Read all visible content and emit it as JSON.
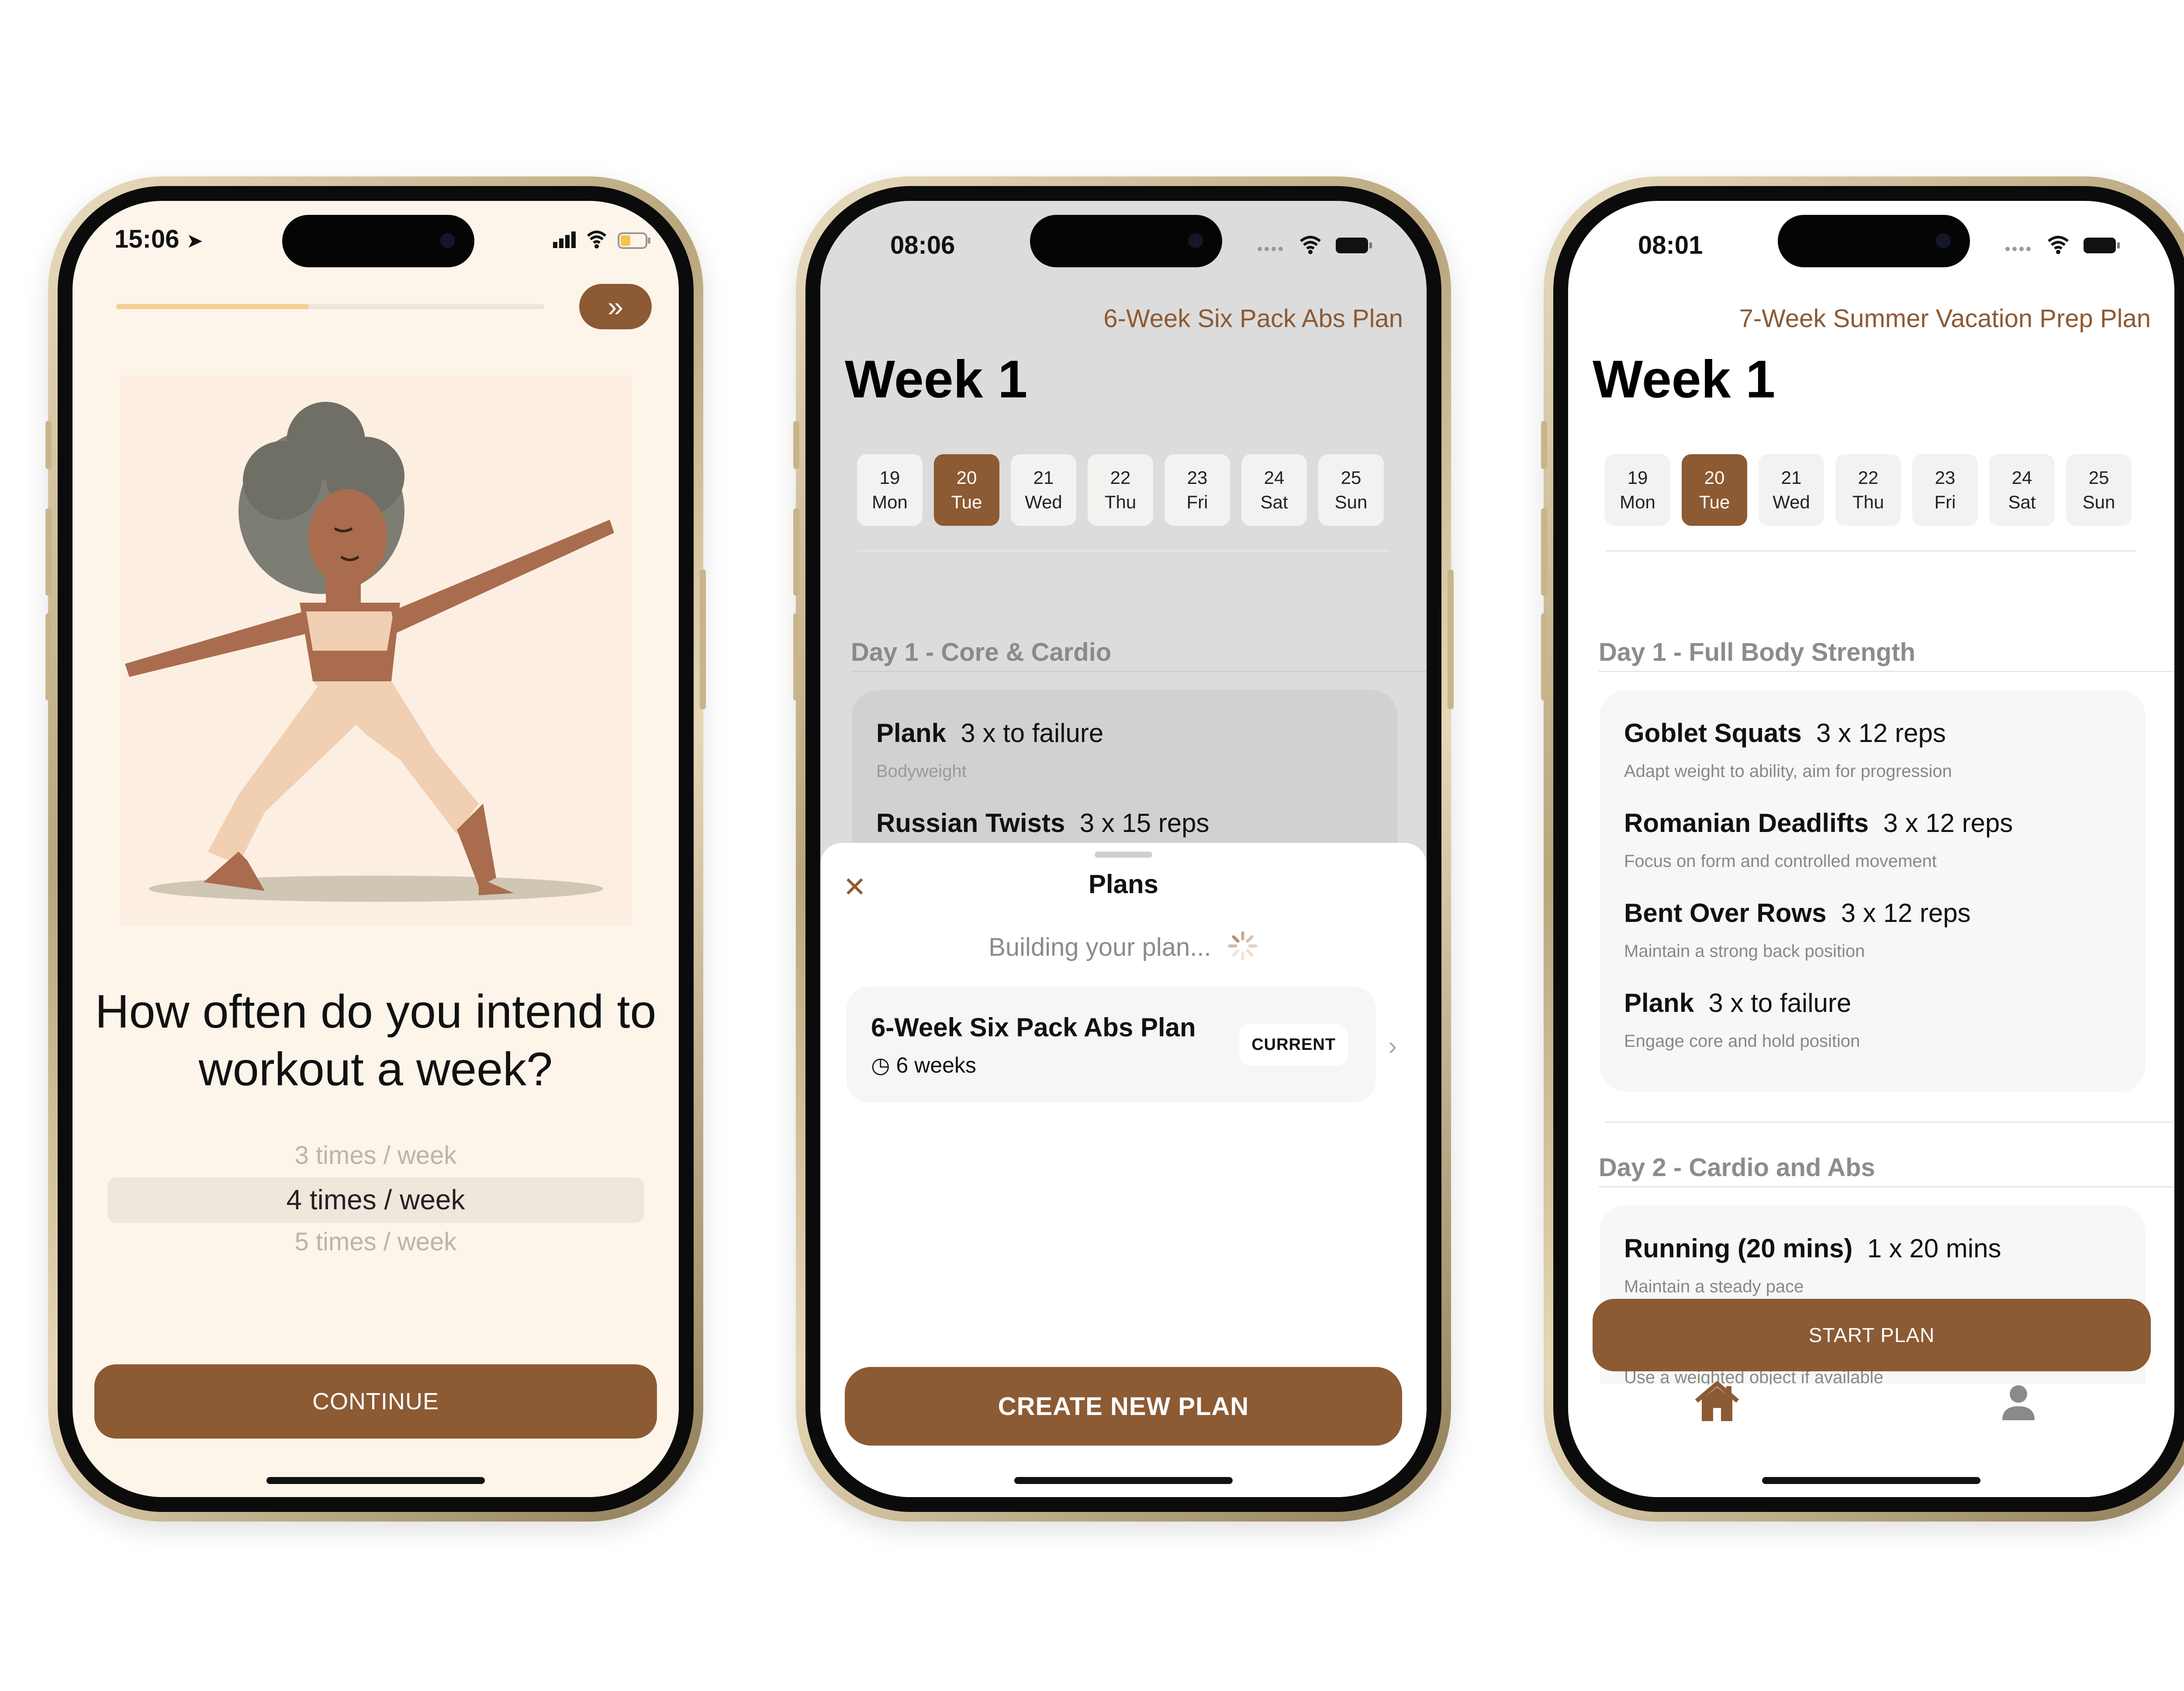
{
  "screen1": {
    "status_time": "15:06",
    "progress": 0.45,
    "skip_icon": "double-chevron-right-icon",
    "question": "How often do you intend to workout a week?",
    "picker_options": [
      "3 times / week",
      "4 times / week",
      "5 times / week"
    ],
    "picker_selected": "4 times / week",
    "continue_label": "CONTINUE"
  },
  "screen2": {
    "status_time": "08:06",
    "plan_name": "6-Week Six Pack Abs Plan",
    "week_title": "Week 1",
    "days": [
      {
        "num": "19",
        "dow": "Mon"
      },
      {
        "num": "20",
        "dow": "Tue"
      },
      {
        "num": "21",
        "dow": "Wed"
      },
      {
        "num": "22",
        "dow": "Thu"
      },
      {
        "num": "23",
        "dow": "Fri"
      },
      {
        "num": "24",
        "dow": "Sat"
      },
      {
        "num": "25",
        "dow": "Sun"
      }
    ],
    "section_title": "Day 1 - Core & Cardio",
    "exercises": [
      {
        "name": "Plank",
        "detail": "3 x to failure",
        "note": "Bodyweight"
      },
      {
        "name": "Russian Twists",
        "detail": "3 x 15 reps"
      }
    ],
    "sheet": {
      "title": "Plans",
      "building": "Building your plan...",
      "plan_card": {
        "name": "6-Week Six Pack Abs Plan",
        "duration": "6 weeks",
        "badge": "CURRENT"
      },
      "create_label": "CREATE NEW PLAN"
    }
  },
  "screen3": {
    "status_time": "08:01",
    "plan_name": "7-Week Summer Vacation Prep Plan",
    "week_title": "Week 1",
    "days": [
      {
        "num": "19",
        "dow": "Mon"
      },
      {
        "num": "20",
        "dow": "Tue"
      },
      {
        "num": "21",
        "dow": "Wed"
      },
      {
        "num": "22",
        "dow": "Thu"
      },
      {
        "num": "23",
        "dow": "Fri"
      },
      {
        "num": "24",
        "dow": "Sat"
      },
      {
        "num": "25",
        "dow": "Sun"
      }
    ],
    "day1_title": "Day 1 - Full Body Strength",
    "day1_exercises": [
      {
        "name": "Goblet Squats",
        "detail": "3 x 12 reps",
        "note": "Adapt weight to ability, aim for progression"
      },
      {
        "name": "Romanian Deadlifts",
        "detail": "3 x 12 reps",
        "note": "Focus on form and controlled movement"
      },
      {
        "name": "Bent Over Rows",
        "detail": "3 x 12 reps",
        "note": "Maintain a strong back position"
      },
      {
        "name": "Plank",
        "detail": "3 x to failure",
        "note": "Engage core and hold position"
      }
    ],
    "day2_title": "Day 2 - Cardio and Abs",
    "day2_exercises": [
      {
        "name": "Running (20 mins)",
        "detail": "1 x 20 mins",
        "note": "Maintain a steady pace"
      }
    ],
    "hidden_note": "Use a weighted object if available",
    "start_label": "START PLAN",
    "tabs": [
      "home-icon",
      "profile-icon"
    ]
  },
  "colors": {
    "accent": "#8c5a33",
    "bg_warm": "#fdf4ea",
    "progress": "#f6cf94"
  }
}
